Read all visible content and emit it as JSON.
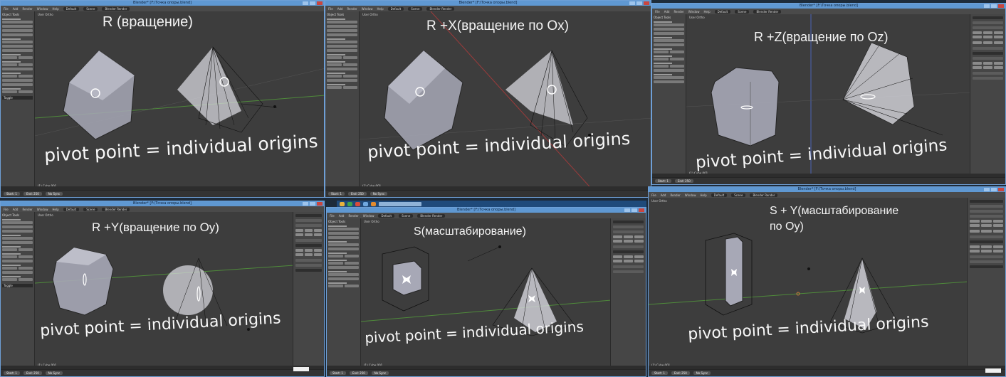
{
  "window_title": "Blender* [F:\\Точка опоры.blend]",
  "menu": [
    "File",
    "Add",
    "Render",
    "Window",
    "Help"
  ],
  "layout": "Default",
  "scene": "Scene",
  "engine": "Blender Render",
  "viewport_label": "User Ortho",
  "object_label": "(1) Cube.001",
  "tool_shelf": {
    "title": "Object Tools",
    "toggle": "Toggle"
  },
  "timeline": {
    "start_label": "Start: 1",
    "end_label": "End: 250",
    "sync": "No Sync"
  },
  "caption_common": "pivot point = individual origins",
  "panels": [
    {
      "caption": "R (вращение)"
    },
    {
      "caption": "R +X(вращение по Ox)"
    },
    {
      "caption": "R +Z(вращение по Oz)"
    },
    {
      "caption": "R +Y(вращение по Oy)"
    },
    {
      "caption": "S(масштабирование)"
    },
    {
      "caption_line1": "S + Y(масштабирование",
      "caption_line2": "по Oy)"
    }
  ],
  "colors": {
    "window_border": "#6e9fd6",
    "titlebar": "#5f98d2",
    "viewport": "#3d3d3d",
    "x_axis": "#9c3b3b",
    "y_axis": "#4f8b3b",
    "z_axis": "#4a64b5",
    "selected_cube": "#a7a8b6",
    "cone": "#d7d7de"
  }
}
